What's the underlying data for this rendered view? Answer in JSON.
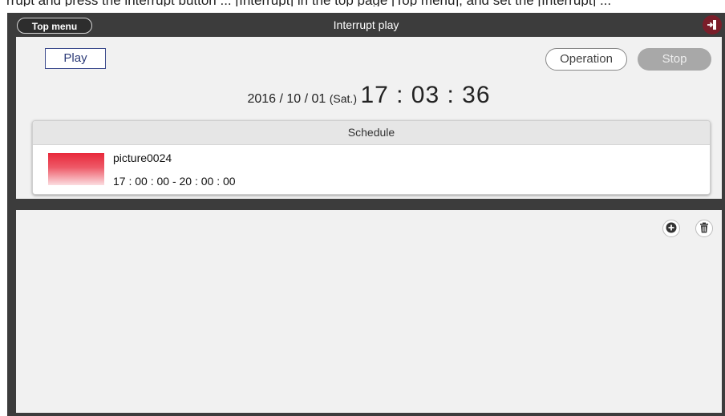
{
  "above": {
    "text": "rrupt and press the interrupt button ... [Interrupt] in the top page [Top menu], and set the [Interrupt] ..."
  },
  "header": {
    "top_menu_label": "Top menu",
    "title": "Interrupt play",
    "exit_icon": "logout-icon"
  },
  "controls": {
    "play_label": "Play",
    "operation_label": "Operation",
    "stop_label": "Stop"
  },
  "clock": {
    "date": "2016 / 10 / 01",
    "weekday": "(Sat.)",
    "time": "17 : 03 : 36"
  },
  "schedule": {
    "header": "Schedule",
    "items": [
      {
        "name": "picture0024",
        "time_range": "17 : 00 : 00 - 20 : 00 : 00",
        "thumb_color": "#e8283a"
      }
    ]
  },
  "list_panel": {
    "add_icon": "plus-circle-icon",
    "delete_icon": "trash-icon"
  },
  "colors": {
    "frame": "#3c3c3c",
    "panel": "#f1f1f1",
    "play_border": "#3b4a8c",
    "stop_disabled": "#a8a8a8",
    "exit_button": "#7a1e2a"
  }
}
